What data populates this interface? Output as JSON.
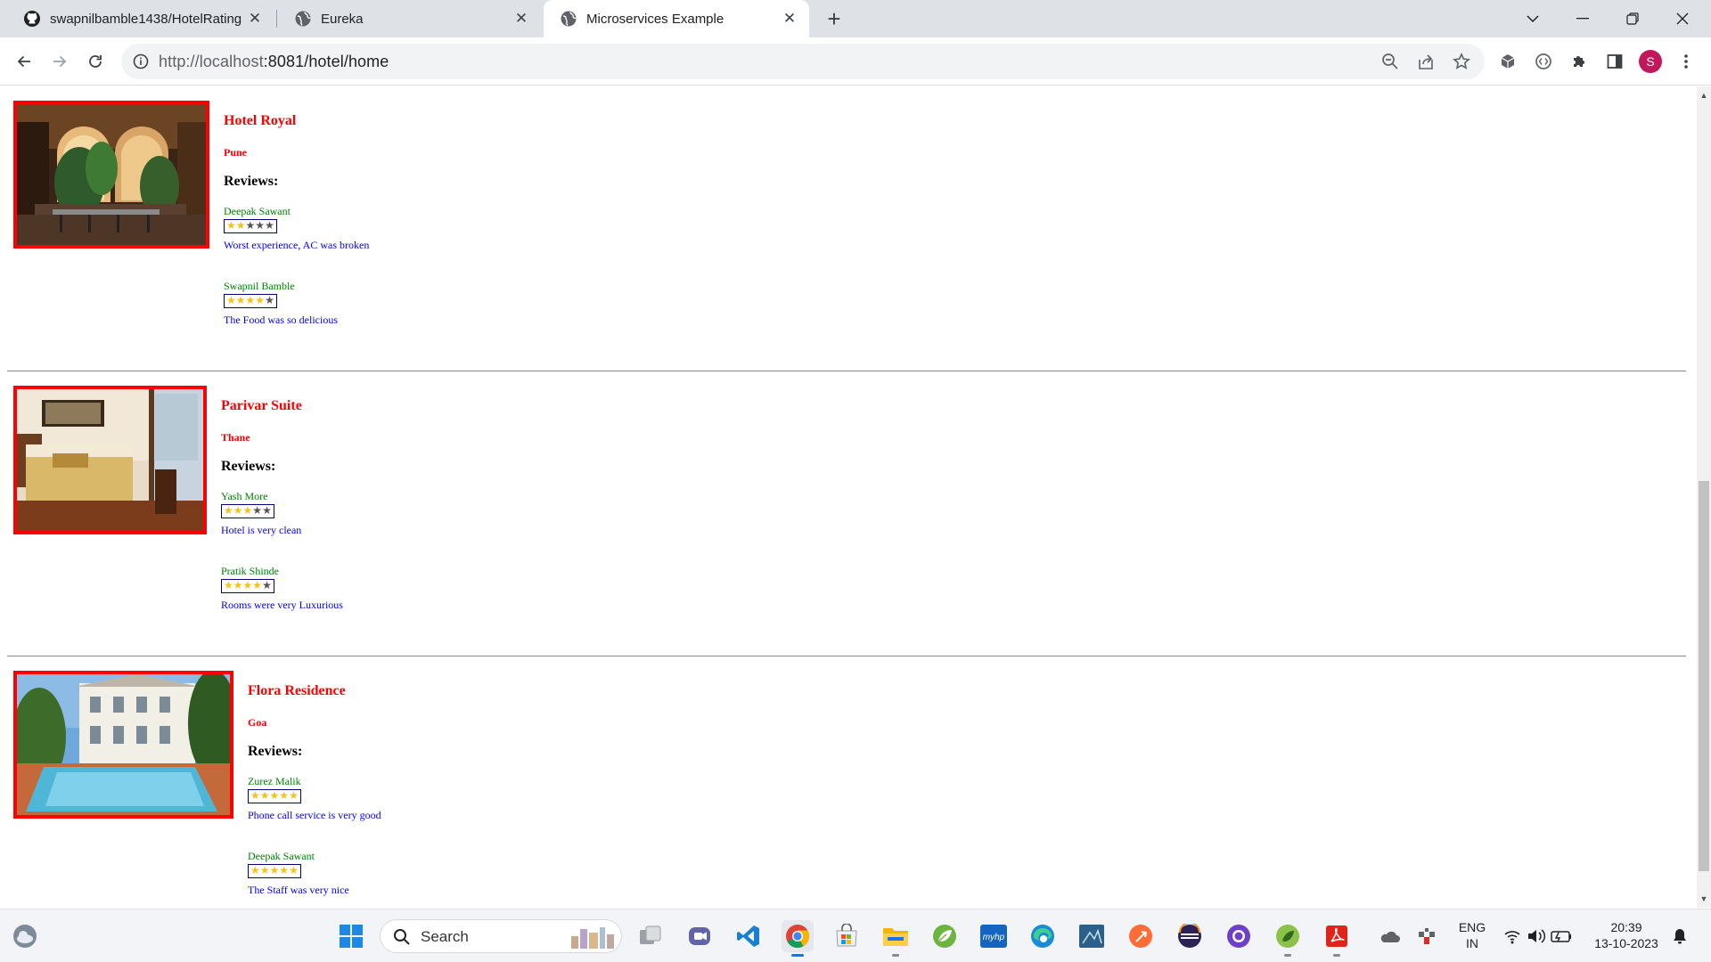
{
  "browser": {
    "tabs": [
      {
        "title": "swapnilbamble1438/HotelRating",
        "icon": "github-icon",
        "active": false
      },
      {
        "title": "Eureka",
        "icon": "globe-icon",
        "active": false
      },
      {
        "title": "Microservices Example",
        "icon": "globe-icon",
        "active": true
      }
    ],
    "address": {
      "host": "http://localhost",
      "path": ":8081/hotel/home"
    },
    "profile_initial": "S"
  },
  "page": {
    "reviews_heading": "Reviews:",
    "hotels": [
      {
        "name": "Hotel Royal",
        "location": "Pune",
        "reviews": [
          {
            "user": "Deepak Sawant",
            "rating": 2,
            "feedback": "Worst experience, AC was broken"
          },
          {
            "user": "Swapnil Bamble",
            "rating": 4,
            "feedback": "The Food was so delicious"
          }
        ]
      },
      {
        "name": "Parivar Suite",
        "location": "Thane",
        "reviews": [
          {
            "user": "Yash More",
            "rating": 3,
            "feedback": "Hotel is very clean"
          },
          {
            "user": "Pratik Shinde",
            "rating": 4,
            "feedback": "Rooms were very Luxurious"
          }
        ]
      },
      {
        "name": "Flora Residence",
        "location": "Goa",
        "reviews": [
          {
            "user": "Zurez Malik",
            "rating": 5,
            "feedback": "Phone call service is very good"
          },
          {
            "user": "Deepak Sawant",
            "rating": 5,
            "feedback": "The Staff was very nice"
          }
        ]
      }
    ]
  },
  "taskbar": {
    "search_label": "Search",
    "language": "ENG",
    "region": "IN",
    "time": "20:39",
    "date": "13-10-2023"
  },
  "colors": {
    "hotel_name": "#ff0000",
    "user_name": "#008000",
    "feedback": "#0000ff",
    "image_border": "#ff0000",
    "star_on": "#f3c21e"
  }
}
